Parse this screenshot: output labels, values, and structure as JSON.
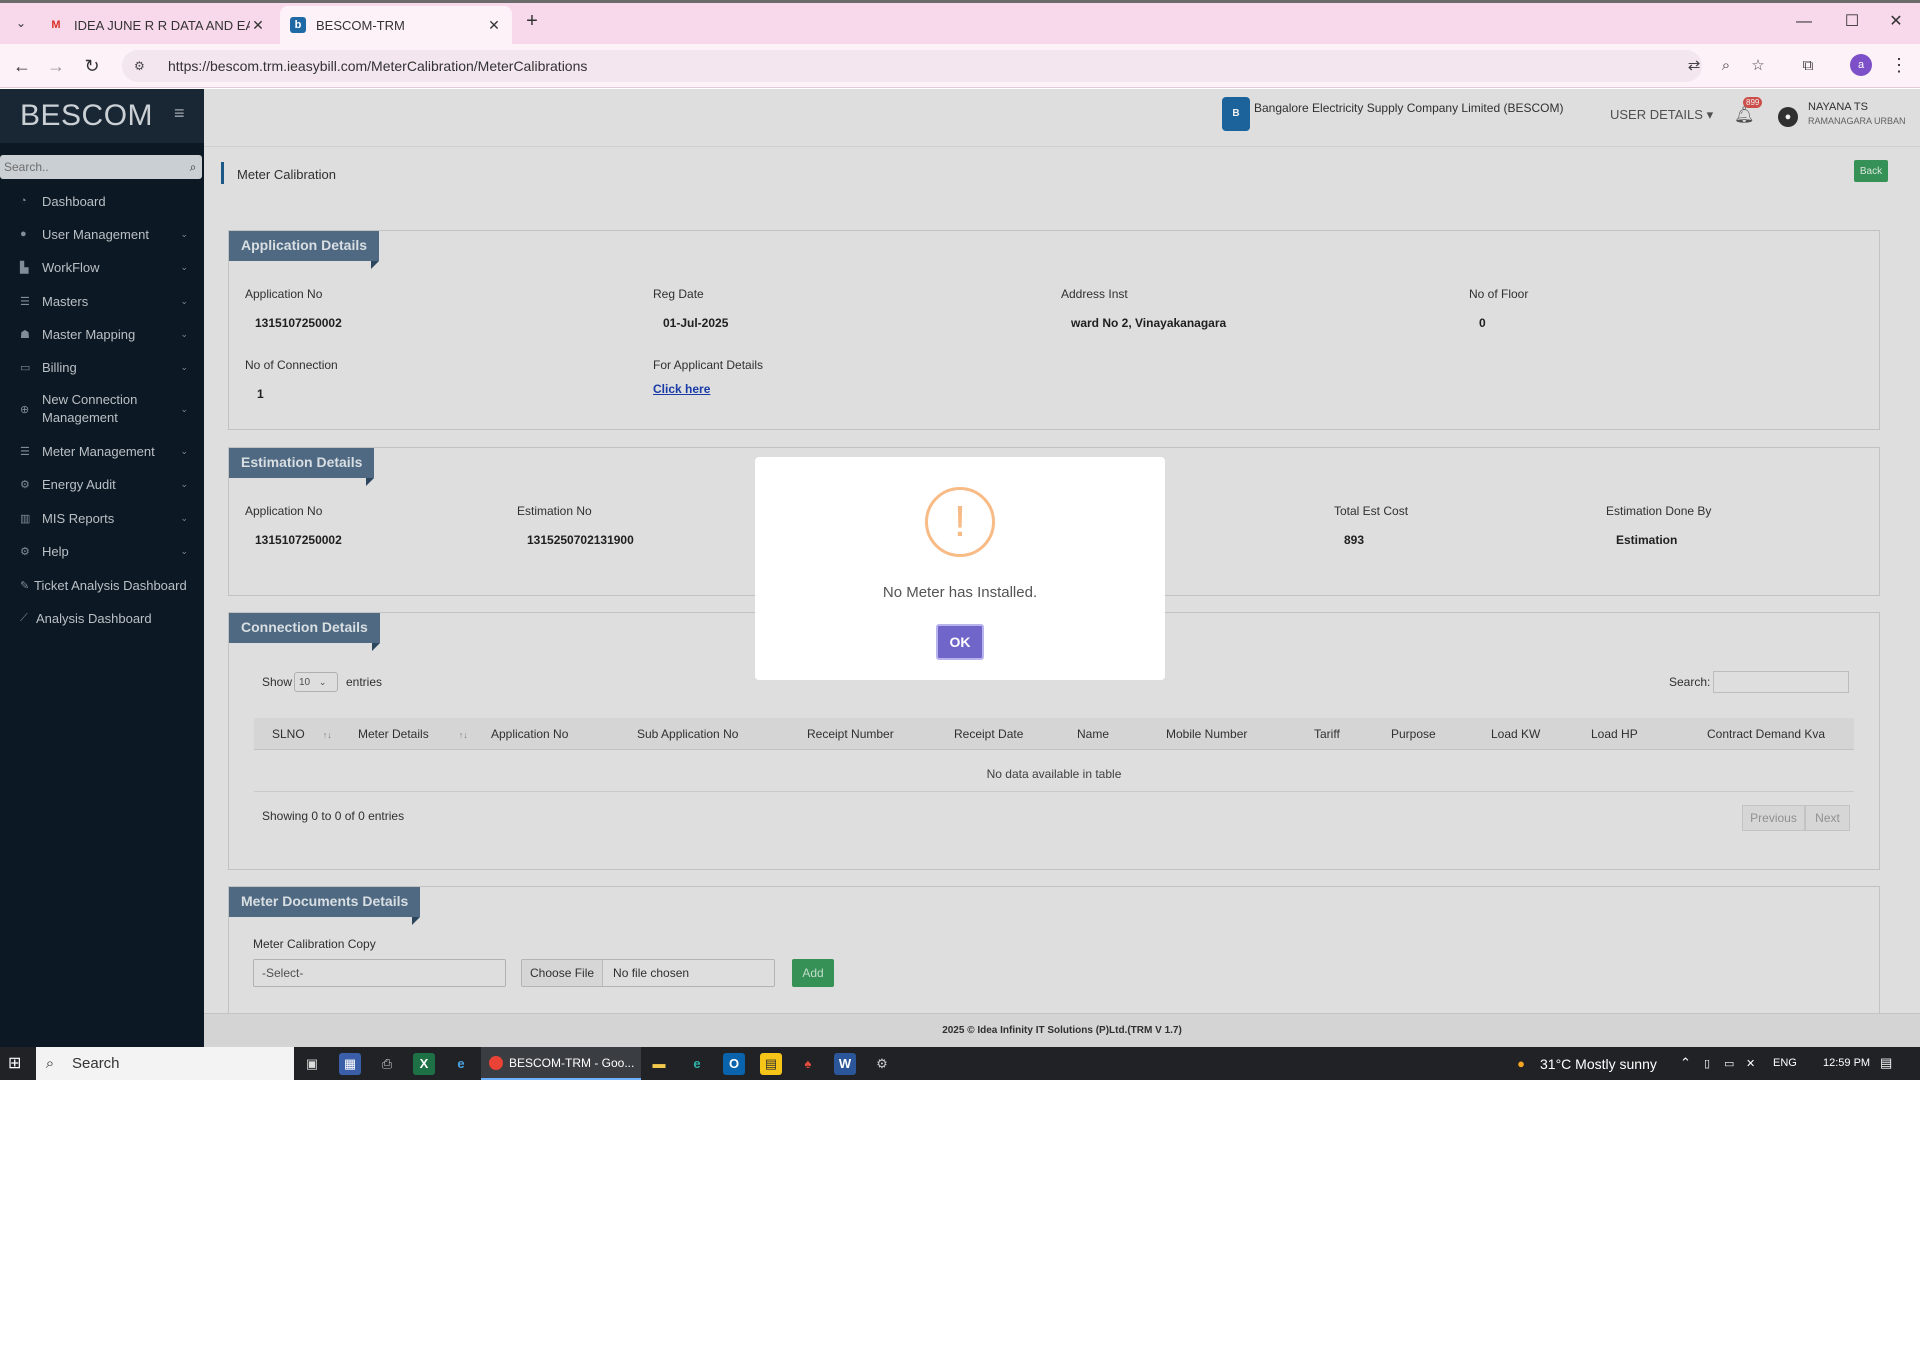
{
  "browser": {
    "tabs": [
      {
        "title": "IDEA JUNE R R DATA AND EA -",
        "icon": "gmail-icon"
      },
      {
        "title": "BESCOM-TRM",
        "icon": "bescom-icon"
      }
    ],
    "url": "https://bescom.trm.ieasybill.com/MeterCalibration/MeterCalibrations",
    "profile_initial": "a"
  },
  "sidebar": {
    "logo": "BESCOM",
    "search_placeholder": "Search..",
    "items": [
      {
        "label": "Dashboard",
        "icon": "dashboard-icon",
        "has_children": false
      },
      {
        "label": "User Management",
        "icon": "user-icon",
        "has_children": true
      },
      {
        "label": "WorkFlow",
        "icon": "workflow-icon",
        "has_children": true
      },
      {
        "label": "Masters",
        "icon": "list-icon",
        "has_children": true
      },
      {
        "label": "Master Mapping",
        "icon": "sitemap-icon",
        "has_children": true
      },
      {
        "label": "Billing",
        "icon": "monitor-icon",
        "has_children": true
      },
      {
        "label": "New Connection Management",
        "icon": "plus-circle-icon",
        "has_children": true
      },
      {
        "label": "Meter Management",
        "icon": "list-icon",
        "has_children": true
      },
      {
        "label": "Energy Audit",
        "icon": "gears-icon",
        "has_children": true
      },
      {
        "label": "MIS Reports",
        "icon": "bar-chart-icon",
        "has_children": true
      },
      {
        "label": "Help",
        "icon": "help-icon",
        "has_children": true
      },
      {
        "label": "Ticket Analysis Dashboard",
        "icon": "pen-icon",
        "has_children": false
      },
      {
        "label": "Analysis Dashboard",
        "icon": "line-chart-icon",
        "has_children": false
      }
    ]
  },
  "header": {
    "org_name": "Bangalore Electricity Supply Company Limited (BESCOM)",
    "user_details_label": "USER DETAILS",
    "notification_count": "899",
    "user_name": "NAYANA TS",
    "user_location": "RAMANAGARA URBAN"
  },
  "page": {
    "title": "Meter Calibration",
    "back_label": "Back"
  },
  "application_details": {
    "heading": "Application Details",
    "fields": [
      {
        "label": "Application No",
        "value": "1315107250002"
      },
      {
        "label": "Reg Date",
        "value": "01-Jul-2025"
      },
      {
        "label": "Address Inst",
        "value": "ward No 2, Vinayakanagara"
      },
      {
        "label": "No of Floor",
        "value": "0"
      },
      {
        "label": "No of Connection",
        "value": "1"
      }
    ],
    "applicant_label": "For Applicant Details",
    "applicant_link": "Click here"
  },
  "estimation_details": {
    "heading": "Estimation Details",
    "fields": [
      {
        "label": "Application No",
        "value": "1315107250002"
      },
      {
        "label": "Estimation No",
        "value": "1315250702131900"
      },
      {
        "label": "Total Est Cost",
        "value": "893"
      },
      {
        "label": "Estimation Done By",
        "value": "Estimation"
      }
    ]
  },
  "connection_details": {
    "heading": "Connection Details",
    "show_label": "Show",
    "entries_value": "10",
    "entries_label": "entries",
    "search_label": "Search:",
    "columns": [
      "SLNO",
      "Meter Details",
      "Application No",
      "Sub Application No",
      "Receipt Number",
      "Receipt Date",
      "Name",
      "Mobile Number",
      "Tariff",
      "Purpose",
      "Load KW",
      "Load HP",
      "Contract Demand Kva"
    ],
    "empty_message": "No data available in table",
    "info": "Showing 0 to 0 of 0 entries",
    "prev_label": "Previous",
    "next_label": "Next"
  },
  "meter_documents": {
    "heading": "Meter Documents Details",
    "copy_label": "Meter Calibration Copy",
    "select_value": "-Select-",
    "choose_file_label": "Choose File",
    "no_file_label": "No file chosen",
    "add_label": "Add"
  },
  "footer": {
    "text": "2025 © Idea Infinity IT Solutions (P)Ltd.(TRM V 1.7)"
  },
  "modal": {
    "icon": "warning-icon",
    "symbol": "!",
    "message": "No Meter has Installed.",
    "ok_label": "OK"
  },
  "taskbar": {
    "search_label": "Search",
    "active_app": "BESCOM-TRM - Goo...",
    "weather": "31°C  Mostly sunny",
    "language": "ENG",
    "time": "12:59 PM"
  },
  "colors": {
    "sidebar_bg": "#0d1a26",
    "panel_header": "#53708a",
    "ok_button": "#7066c9",
    "warning": "#f8bb86",
    "success_button": "#3a9b5c"
  }
}
